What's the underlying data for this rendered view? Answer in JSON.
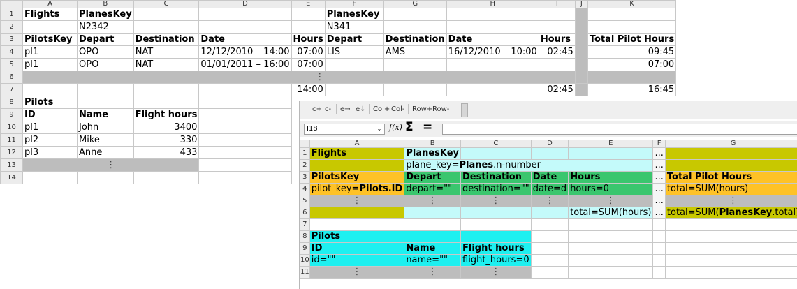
{
  "sheet1": {
    "cols": [
      "A",
      "B",
      "C",
      "D",
      "E",
      "F",
      "G",
      "H",
      "I",
      "J",
      "K"
    ],
    "rows": [
      "1",
      "2",
      "3",
      "4",
      "5",
      "6",
      "7",
      "8",
      "9",
      "10",
      "11",
      "12",
      "13",
      "14"
    ],
    "r1": {
      "flights": "Flights",
      "planeskey1": "PlanesKey",
      "planeskey2": "PlanesKey"
    },
    "r2": {
      "plane1": "N2342",
      "plane2": "N341"
    },
    "r3": {
      "pilotskey": "PilotsKey",
      "depart1": "Depart",
      "dest1": "Destination",
      "date1": "Date",
      "hours1": "Hours",
      "depart2": "Depart",
      "dest2": "Destination",
      "date2": "Date",
      "hours2": "Hours",
      "total": "Total Pilot Hours"
    },
    "r4": {
      "a": "pl1",
      "b": "OPO",
      "c": "NAT",
      "d": "12/12/2010 – 14:00",
      "e": "07:00",
      "f": "LIS",
      "g": "AMS",
      "h": "16/12/2010 – 10:00",
      "i": "02:45",
      "j": "...",
      "k": "09:45"
    },
    "r5": {
      "a": "pl1",
      "b": "OPO",
      "c": "NAT",
      "d": "01/01/2011 – 16:00",
      "e": "07:00",
      "k": "07:00"
    },
    "r6": {
      "dots": "⋮"
    },
    "r7": {
      "e": "14:00",
      "i": "02:45",
      "k": "16:45"
    },
    "r8": {
      "pilots": "Pilots"
    },
    "r9": {
      "id": "ID",
      "name": "Name",
      "fh": "Flight hours"
    },
    "pilots": [
      {
        "id": "pl1",
        "name": "John",
        "fh": "3400"
      },
      {
        "id": "pl2",
        "name": "Mike",
        "fh": "330"
      },
      {
        "id": "pl3",
        "name": "Anne",
        "fh": "433"
      }
    ],
    "r13": {
      "dots": "⋮"
    }
  },
  "template_window": {
    "toolbar": {
      "c_plus": "c+",
      "c_minus": "c-",
      "e_right": "e→",
      "e_down": "e↓",
      "col_plus": "Col+",
      "col_minus": "Col-",
      "row_plus": "Row+",
      "row_minus": "Row-"
    },
    "formula_bar": {
      "cell_ref": "I18",
      "dropdown": "⌄",
      "fx": "f(x)",
      "sigma": "Σ",
      "equals": "="
    },
    "cols": [
      "A",
      "B",
      "C",
      "D",
      "E",
      "F",
      "G"
    ],
    "rows": [
      "1",
      "2",
      "3",
      "4",
      "5",
      "6",
      "7",
      "8",
      "9",
      "10",
      "11"
    ],
    "r1": {
      "flights": "Flights",
      "planeskey": "PlanesKey",
      "f": "..."
    },
    "r2": {
      "pre": "plane_key=",
      "bold": "Planes",
      "post": ".n-number",
      "f": "..."
    },
    "r3": {
      "pilotskey": "PilotsKey",
      "depart": "Depart",
      "dest": "Destination",
      "date": "Date",
      "hours": "Hours",
      "f": "...",
      "total": "Total Pilot Hours"
    },
    "r4": {
      "pre": "pilot_key=",
      "bold": "Pilots.ID",
      "depart": "depart=\"\"",
      "dest": "destination=\"\"",
      "date": "date=d",
      "hours": "hours=0",
      "f": "...",
      "total": "total=SUM(hours)"
    },
    "r5": {
      "dots": "⋮",
      "f": "..."
    },
    "r6": {
      "e": "total=SUM(hours)",
      "f": "...",
      "pre": "total=SUM(",
      "bold": "PlanesKey",
      "post": ".total)"
    },
    "r8": {
      "pilots": "Pilots"
    },
    "r9": {
      "id": "ID",
      "name": "Name",
      "fh": "Flight hours"
    },
    "r10": {
      "id": "id=\"\"",
      "name": "name=\"\"",
      "fh": "flight_hours=0"
    },
    "r11": {
      "dots": "⋮"
    }
  },
  "colors": {
    "olive": "#c8c800",
    "light_cyan": "#c4fafa",
    "green": "#3ac66e",
    "orange": "#fec227",
    "cyan": "#1ef0f0",
    "grey": "#bdbdbd"
  }
}
